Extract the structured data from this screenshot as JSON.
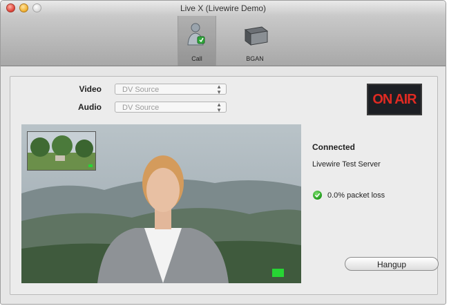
{
  "window": {
    "title": "Live X (Livewire Demo)"
  },
  "toolbar": {
    "items": [
      {
        "label": "Call",
        "icon": "person-call-icon",
        "active": true
      },
      {
        "label": "BGAN",
        "icon": "bgan-terminal-icon",
        "active": false
      }
    ]
  },
  "form": {
    "video_label": "Video",
    "video_value": "DV Source",
    "audio_label": "Audio",
    "audio_value": "DV Source"
  },
  "on_air": {
    "text": "ON AIR",
    "color": "#e02a22"
  },
  "status": {
    "connection": "Connected",
    "server": "Livewire Test Server",
    "packet_loss": "0.0% packet loss",
    "status_icon": "green-check-icon"
  },
  "actions": {
    "hangup_label": "Hangup"
  },
  "colors": {
    "indicator_green": "#27d534"
  }
}
